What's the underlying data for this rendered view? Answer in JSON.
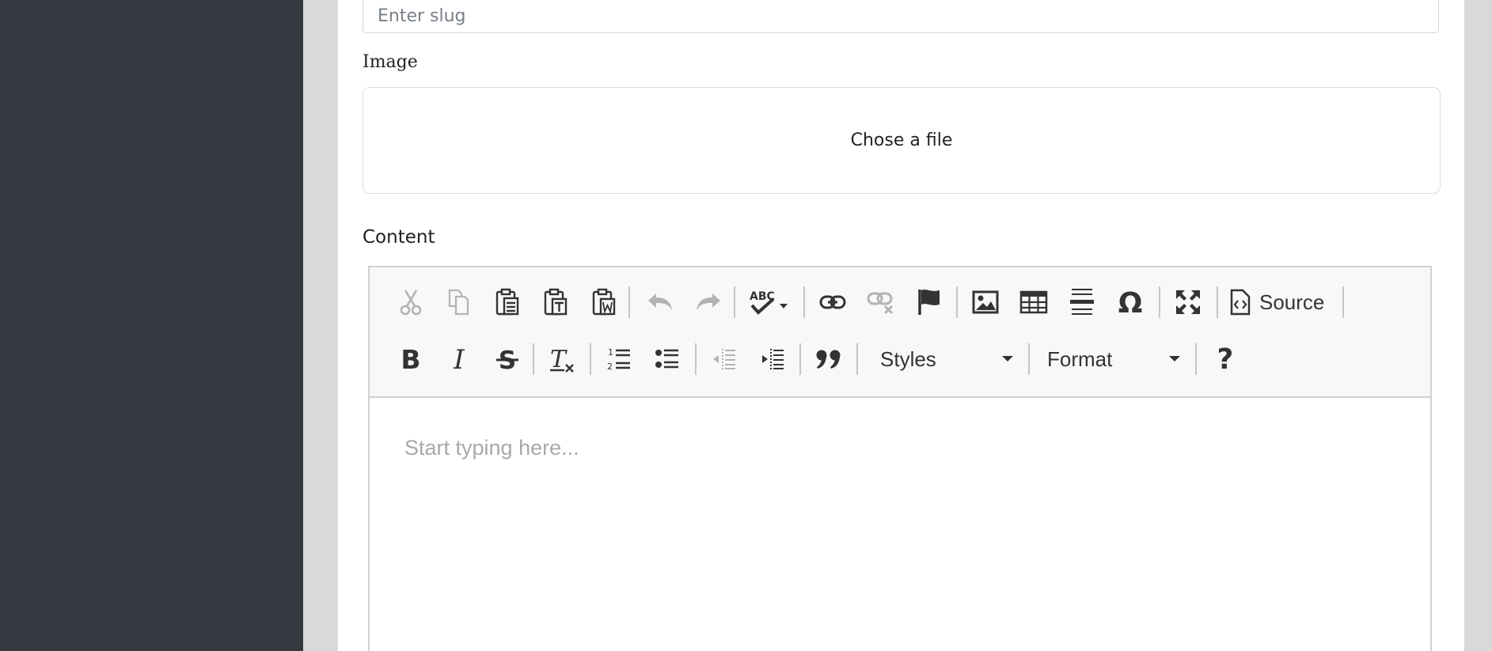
{
  "form": {
    "slug": {
      "placeholder": "Enter slug",
      "value": ""
    },
    "image": {
      "label": "Image",
      "dropzone_text": "Chose a file"
    },
    "content": {
      "label": "Content"
    }
  },
  "editor": {
    "toolbar_row1": {
      "source_label": "Source"
    },
    "toolbar_row2": {
      "styles_label": "Styles",
      "format_label": "Format",
      "help_label": "?"
    },
    "placeholder": "Start typing here..."
  },
  "colors": {
    "sidebar": "#363840",
    "page_background": "#d9d9d9",
    "toolbar_background": "#f8f8f8",
    "icon_active": "#333333",
    "icon_disabled": "#b3b3b3",
    "placeholder_text": "#a9a9a9"
  },
  "icons": [
    "cut-icon",
    "copy-icon",
    "paste-icon",
    "paste-text-icon",
    "paste-word-icon",
    "undo-icon",
    "redo-icon",
    "spellcheck-icon",
    "link-icon",
    "unlink-icon",
    "anchor-icon",
    "image-icon",
    "table-icon",
    "horizontal-line-icon",
    "special-char-icon",
    "maximize-icon",
    "source-icon",
    "bold-icon",
    "italic-icon",
    "strike-icon",
    "remove-format-icon",
    "numbered-list-icon",
    "bulleted-list-icon",
    "outdent-icon",
    "indent-icon",
    "blockquote-icon",
    "help-icon"
  ]
}
